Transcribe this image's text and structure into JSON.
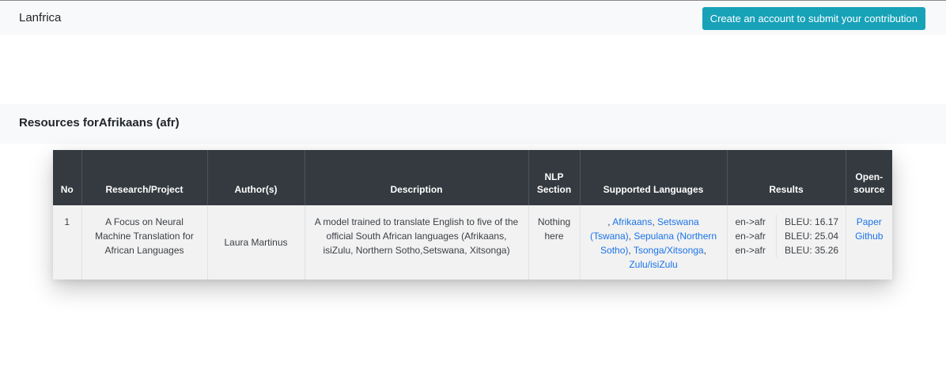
{
  "header": {
    "brand": "Lanfrica",
    "cta_label": "Create an account to submit your contribution"
  },
  "section": {
    "title": "Resources forAfrikaans (afr)"
  },
  "table": {
    "headers": [
      "No",
      "Research/Project",
      "Author(s)",
      "Description",
      "NLP Section",
      "Supported Languages",
      "Results",
      "Open-source"
    ],
    "header_nlp_line1": "NLP",
    "header_nlp_line2": "Section",
    "header_open_line1": "Open-",
    "header_open_line2": "source",
    "rows": [
      {
        "no": "1",
        "project": "A Focus on Neural Machine Translation for African Languages",
        "authors": "Laura Martinus",
        "description": "A model trained to translate English to five of the official South African languages (Afrikaans, isiZulu, Northern Sotho,Setswana, Xitsonga)",
        "nlp_section": "Nothing here",
        "languages_prefix": ", ",
        "languages": [
          {
            "name": "Afrikaans",
            "sep": ", "
          },
          {
            "name": "Setswana (Tswana)",
            "sep": ", "
          },
          {
            "name": "Sepulana (Northern Sotho)",
            "sep": ", "
          },
          {
            "name": "Tsonga/Xitsonga",
            "sep": ", "
          },
          {
            "name": "Zulu/isiZulu",
            "sep": ""
          }
        ],
        "results": [
          {
            "pair": "en->afr",
            "score": "BLEU: 16.17"
          },
          {
            "pair": "en->afr",
            "score": "BLEU: 25.04"
          },
          {
            "pair": "en->afr",
            "score": "BLEU: 35.26"
          }
        ],
        "open_source": [
          "Paper",
          "Github"
        ]
      }
    ]
  },
  "colors": {
    "cta_bg": "#17a2b8",
    "table_header_bg": "#343a40",
    "link": "#1a73e8"
  }
}
